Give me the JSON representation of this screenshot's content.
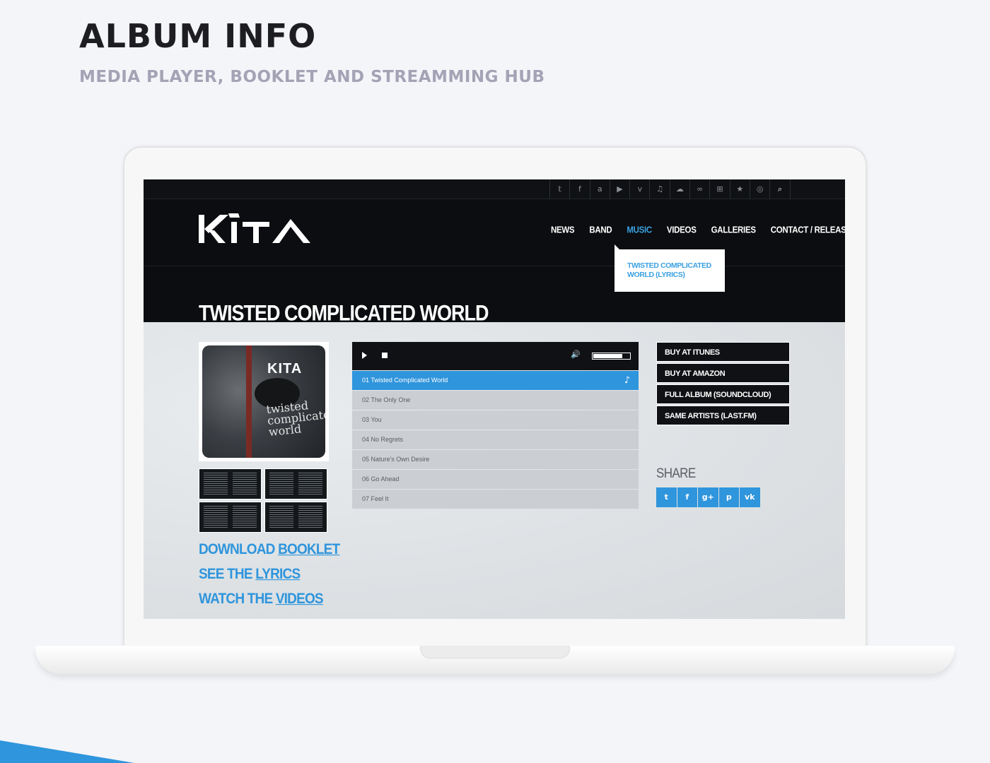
{
  "page": {
    "title": "ALBUM INFO",
    "subtitle": "MEDIA PLAYER, BOOKLET AND STREAMMING HUB"
  },
  "colors": {
    "accent": "#2f95dc",
    "nav_active": "#3aa0e0",
    "header_bg": "#0b0d10",
    "page_bg": "#f3f5f9"
  },
  "site": {
    "social_icons": [
      "twitter-icon",
      "facebook-icon",
      "amazon-icon",
      "youtube-icon",
      "vimeo-icon",
      "music-note-icon",
      "soundcloud-icon",
      "lastfm-icon",
      "windows-icon",
      "star-icon",
      "instagram-icon",
      "search-icon"
    ],
    "social_glyphs": [
      "𝕥",
      "f",
      "a",
      "▶",
      "v",
      "♫",
      "☁",
      "∞",
      "⊞",
      "★",
      "◎",
      "⌕"
    ],
    "nav": [
      {
        "label": "NEWS",
        "active": false
      },
      {
        "label": "BAND",
        "active": false
      },
      {
        "label": "MUSIC",
        "active": true
      },
      {
        "label": "VIDEOS",
        "active": false
      },
      {
        "label": "GALLERIES",
        "active": false
      },
      {
        "label": "CONTACT / RELEASE",
        "active": false
      }
    ],
    "dropdown_item": "TWISTED COMPLICATED WORLD (LYRICS)",
    "album_title": "TWISTED COMPLICATED WORLD",
    "cover": {
      "logo": "KITA",
      "text": "twisted complicated world"
    },
    "links": [
      {
        "prefix": "DOWNLOAD ",
        "link": "BOOKLET"
      },
      {
        "prefix": "SEE THE ",
        "link": "LYRICS"
      },
      {
        "prefix": "WATCH THE ",
        "link": "VIDEOS"
      }
    ],
    "player": {
      "volume": 0.8,
      "tracks": [
        "01 Twisted Complicated World",
        "02 The Only One",
        "03 You",
        "04 No Regrets",
        "05 Nature's Own Desire",
        "06 Go Ahead",
        "07 Feel It"
      ],
      "active_track": 0
    },
    "buy": [
      "BUY AT ITUNES",
      "BUY AT AMAZON",
      "FULL ALBUM (SOUNDCLOUD)",
      "SAME ARTISTS (LAST.FM)"
    ],
    "share_label": "SHARE",
    "share": [
      {
        "icon": "twitter-icon",
        "glyph": "t"
      },
      {
        "icon": "facebook-icon",
        "glyph": "f"
      },
      {
        "icon": "google-plus-icon",
        "glyph": "g+"
      },
      {
        "icon": "pinterest-icon",
        "glyph": "p"
      },
      {
        "icon": "vk-icon",
        "glyph": "vk"
      }
    ]
  }
}
